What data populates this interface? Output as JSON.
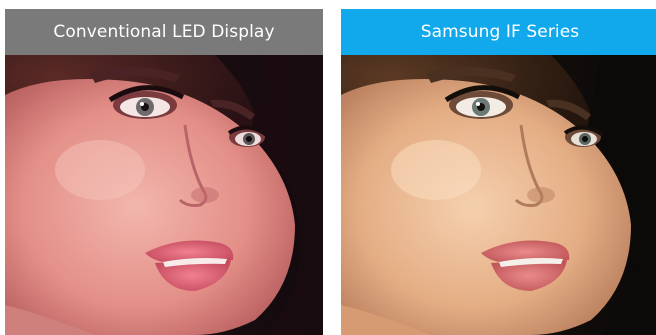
{
  "comparison": {
    "left": {
      "label": "Conventional LED Display",
      "header_color": "#7a7a7a",
      "skin_tone": "#e79a92",
      "background_tone": "#1a0e12"
    },
    "right": {
      "label": "Samsung IF Series",
      "header_color": "#12a9ec",
      "skin_tone": "#e8b38b",
      "background_tone": "#0d0b0a"
    }
  }
}
